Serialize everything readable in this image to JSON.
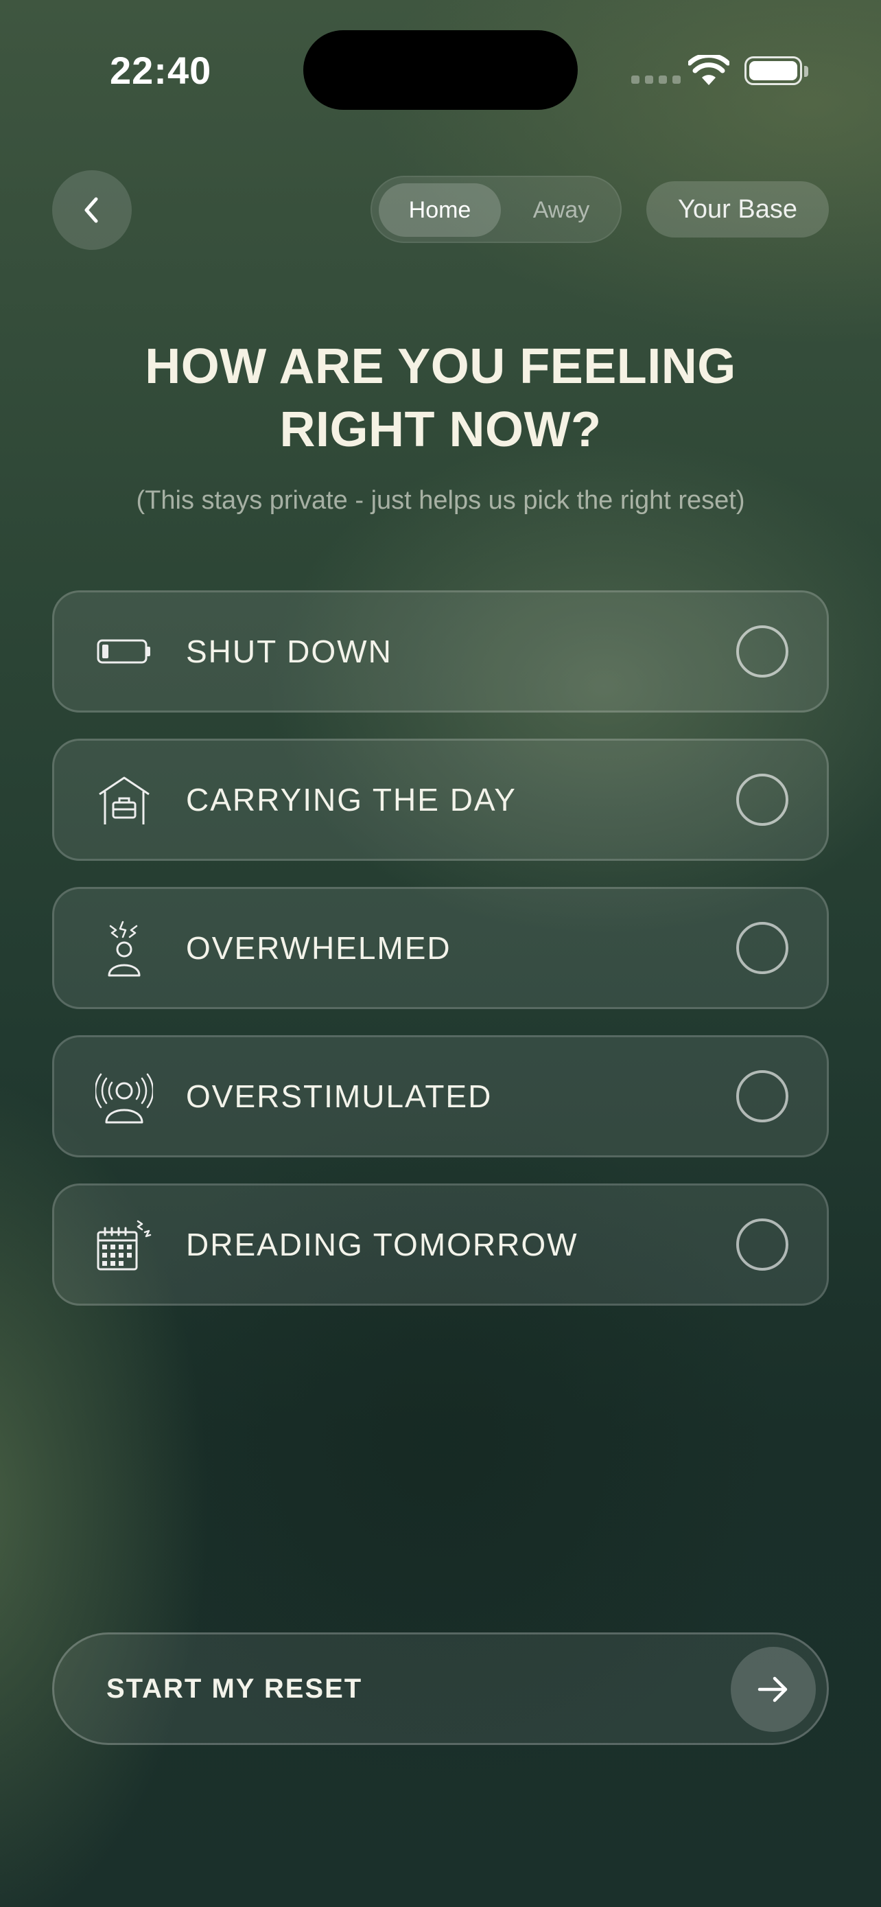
{
  "status_bar": {
    "time": "22:40"
  },
  "top": {
    "back_icon": "chevron-left-icon",
    "segment": {
      "options": [
        "Home",
        "Away"
      ],
      "selected": "Home"
    },
    "base_label": "Your Base"
  },
  "heading": {
    "title_line1": "HOW ARE YOU FEELING",
    "title_line2": "RIGHT NOW?",
    "subtitle": "(This stays private - just helps us pick the right reset)"
  },
  "options": [
    {
      "label": "SHUT DOWN",
      "icon": "low-battery-icon",
      "selected": false
    },
    {
      "label": "CARRYING THE DAY",
      "icon": "house-briefcase-icon",
      "selected": false
    },
    {
      "label": "OVERWHELMED",
      "icon": "stressed-person-icon",
      "selected": false
    },
    {
      "label": "OVERSTIMULATED",
      "icon": "person-sound-waves-icon",
      "selected": false
    },
    {
      "label": "DREADING TOMORROW",
      "icon": "calendar-stress-icon",
      "selected": false
    }
  ],
  "cta": {
    "label": "START MY RESET",
    "icon": "arrow-right-icon"
  },
  "colors": {
    "background": "#223a30",
    "text": "#f3f3ea",
    "title": "#f5f2e4"
  }
}
